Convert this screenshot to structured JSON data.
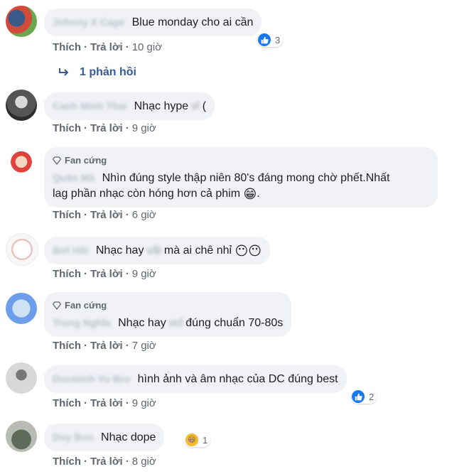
{
  "colors": {
    "link": "#385898",
    "bubble": "#f0f2f5",
    "meta": "#606770",
    "like": "#1877f2"
  },
  "actions": {
    "like": "Thích",
    "reply": "Trả lời",
    "sep": "·"
  },
  "comments": [
    {
      "author": "Johnny X Cage",
      "text": "Blue monday cho ai cần",
      "time": "10 giờ",
      "reactions": {
        "icon": "like-icon",
        "count": "3"
      }
    },
    {
      "author": "Canh Minh Thai",
      "text": "Nhạc hype",
      "blurred": "vl",
      "after": "(",
      "time": "9 giờ"
    },
    {
      "badge": "Fan cứng",
      "author": "Quân Mã",
      "text": "Nhìn đúng style thập niên 80's đáng mong chờ phết.Nhất",
      "text2": "lag phần nhạc còn hóng hơn cả phim",
      "emoji": "😁",
      "after": ".",
      "time": "6 giờ"
    },
    {
      "author": "Bơi Hồi",
      "text": "Nhạc hay",
      "blurred": "vãi",
      "text_b": "mà ai chê nhỉ",
      "emoji": "😶😶",
      "time": "9 giờ"
    },
    {
      "badge": "Fan cứng",
      "author": "Trung Nghĩa",
      "text": "Nhạc hay",
      "blurred": "vcl",
      "text_b": "đúng chuẩn 70-80s",
      "time": "7 giờ"
    },
    {
      "author": "Ducminh Vu Bro",
      "text": "hình ảnh và âm nhạc của DC đúng best",
      "time": "9 giờ",
      "reactions": {
        "icon": "like-icon",
        "count": "2"
      }
    },
    {
      "author": "Duy Bon",
      "text": "Nhạc dope",
      "time": "8 giờ",
      "reactions": {
        "icon": "haha-icon",
        "count": "1"
      }
    }
  ],
  "replies_link": {
    "icon": "reply-arrow-icon",
    "label": "1 phản hồi"
  }
}
